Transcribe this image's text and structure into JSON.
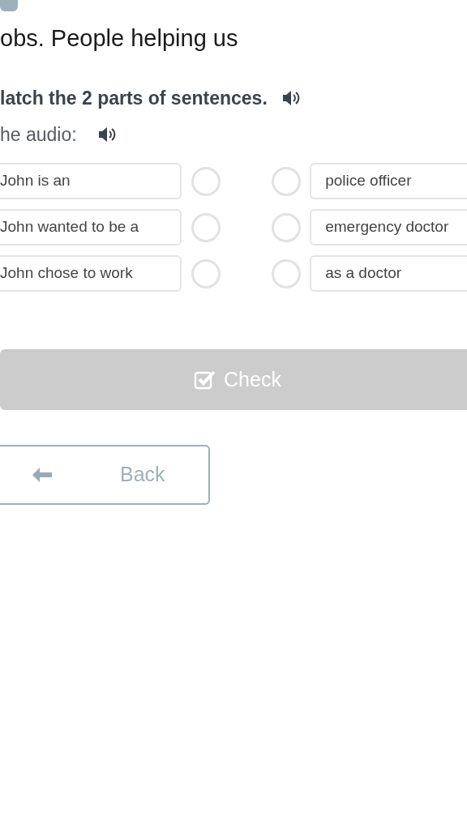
{
  "title": "obs. People helping us",
  "instruction": "latch the 2 parts of sentences.",
  "audio_label": "he audio:",
  "left_items": [
    {
      "text": "John is an",
      "selected": false
    },
    {
      "text": "John wanted to be a",
      "selected": false
    },
    {
      "text": "John chose to work",
      "selected": false
    }
  ],
  "right_items": [
    {
      "text": "police officer",
      "selected": false
    },
    {
      "text": "emergency doctor",
      "selected": false
    },
    {
      "text": "as a doctor",
      "selected": false
    }
  ],
  "check_button": {
    "label": "Check",
    "disabled": true
  },
  "back_button": {
    "label": "Back"
  }
}
